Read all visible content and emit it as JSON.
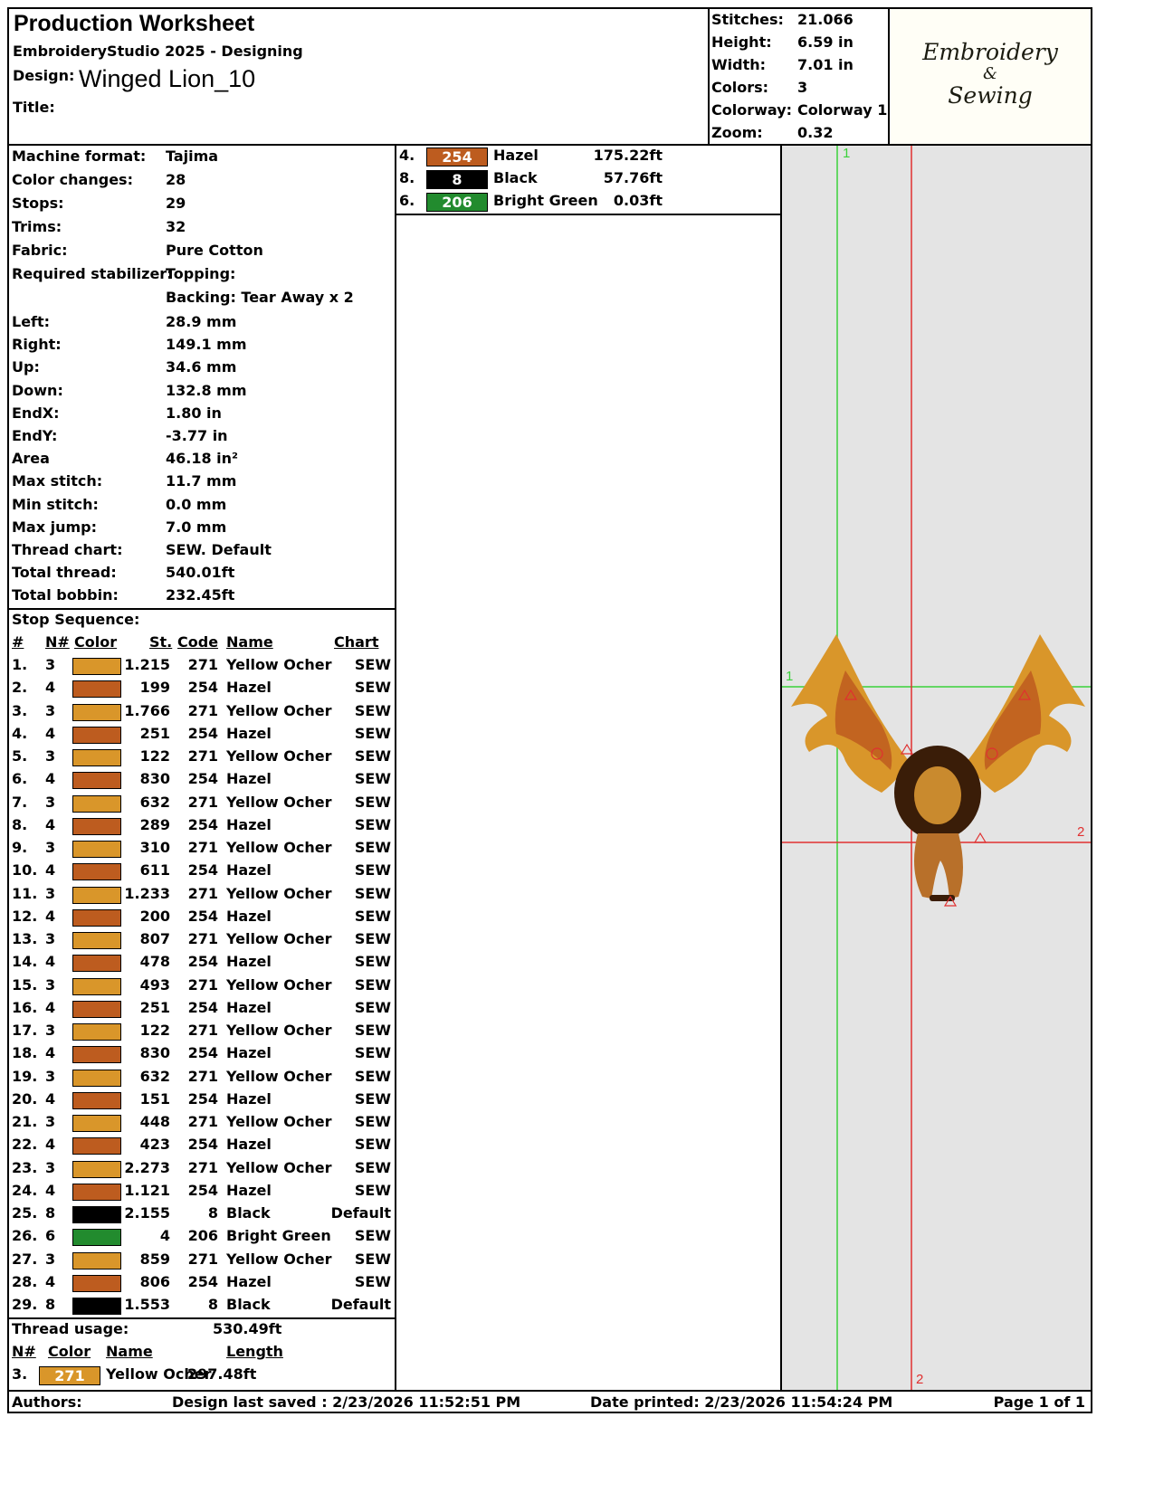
{
  "header": {
    "title": "Production Worksheet",
    "software": "EmbroideryStudio 2025 - Designing",
    "design_label": "Design:",
    "design_name": "Winged Lion_10",
    "title_label": "Title:",
    "title_value": ""
  },
  "summary": [
    {
      "label": "Stitches:",
      "value": "21.066"
    },
    {
      "label": "Height:",
      "value": "6.59 in"
    },
    {
      "label": "Width:",
      "value": "7.01 in"
    },
    {
      "label": "Colors:",
      "value": "3"
    },
    {
      "label": "Colorway:",
      "value": "Colorway 1"
    },
    {
      "label": "Zoom:",
      "value": "0.32"
    }
  ],
  "logo": {
    "line1": "Embroidery",
    "line2": "&",
    "line3": "Sewing"
  },
  "machine_info": [
    {
      "label": "Machine format:",
      "value": "Tajima"
    },
    {
      "label": "Color changes:",
      "value": "28"
    },
    {
      "label": "Stops:",
      "value": "29"
    },
    {
      "label": "Trims:",
      "value": "32"
    },
    {
      "label": "Fabric:",
      "value": "Pure Cotton"
    },
    {
      "label": "Required stabilizer:",
      "value": "Topping:"
    },
    {
      "label": "",
      "value": "Backing: Tear Away x 2"
    }
  ],
  "dimensions": [
    {
      "label": "Left:",
      "value": "28.9 mm"
    },
    {
      "label": "Right:",
      "value": "149.1 mm"
    },
    {
      "label": "Up:",
      "value": "34.6 mm"
    },
    {
      "label": "Down:",
      "value": "132.8 mm"
    },
    {
      "label": "EndX:",
      "value": "1.80 in"
    },
    {
      "label": "EndY:",
      "value": "-3.77 in"
    },
    {
      "label": "Area",
      "value": "46.18 in²"
    },
    {
      "label": "Max stitch:",
      "value": "11.7 mm"
    },
    {
      "label": "Min stitch:",
      "value": "0.0 mm"
    },
    {
      "label": "Max jump:",
      "value": "7.0 mm"
    },
    {
      "label": "Thread chart:",
      "value": "SEW. Default"
    },
    {
      "label": "Total thread:",
      "value": "540.01ft"
    },
    {
      "label": "Total bobbin:",
      "value": "232.45ft"
    }
  ],
  "stop_sequence": {
    "title": "Stop Sequence:",
    "headers": {
      "num": "#",
      "n": "N#",
      "color": "Color",
      "st": "St.",
      "code": "Code",
      "name": "Name",
      "chart": "Chart"
    },
    "rows": [
      {
        "num": "1.",
        "n": "3",
        "color": "#D9962A",
        "st": "1.215",
        "code": "271",
        "name": "Yellow Ocher",
        "chart": "SEW"
      },
      {
        "num": "2.",
        "n": "4",
        "color": "#BD5C1F",
        "st": "199",
        "code": "254",
        "name": "Hazel",
        "chart": "SEW"
      },
      {
        "num": "3.",
        "n": "3",
        "color": "#D9962A",
        "st": "1.766",
        "code": "271",
        "name": "Yellow Ocher",
        "chart": "SEW"
      },
      {
        "num": "4.",
        "n": "4",
        "color": "#BD5C1F",
        "st": "251",
        "code": "254",
        "name": "Hazel",
        "chart": "SEW"
      },
      {
        "num": "5.",
        "n": "3",
        "color": "#D9962A",
        "st": "122",
        "code": "271",
        "name": "Yellow Ocher",
        "chart": "SEW"
      },
      {
        "num": "6.",
        "n": "4",
        "color": "#BD5C1F",
        "st": "830",
        "code": "254",
        "name": "Hazel",
        "chart": "SEW"
      },
      {
        "num": "7.",
        "n": "3",
        "color": "#D9962A",
        "st": "632",
        "code": "271",
        "name": "Yellow Ocher",
        "chart": "SEW"
      },
      {
        "num": "8.",
        "n": "4",
        "color": "#BD5C1F",
        "st": "289",
        "code": "254",
        "name": "Hazel",
        "chart": "SEW"
      },
      {
        "num": "9.",
        "n": "3",
        "color": "#D9962A",
        "st": "310",
        "code": "271",
        "name": "Yellow Ocher",
        "chart": "SEW"
      },
      {
        "num": "10.",
        "n": "4",
        "color": "#BD5C1F",
        "st": "611",
        "code": "254",
        "name": "Hazel",
        "chart": "SEW"
      },
      {
        "num": "11.",
        "n": "3",
        "color": "#D9962A",
        "st": "1.233",
        "code": "271",
        "name": "Yellow Ocher",
        "chart": "SEW"
      },
      {
        "num": "12.",
        "n": "4",
        "color": "#BD5C1F",
        "st": "200",
        "code": "254",
        "name": "Hazel",
        "chart": "SEW"
      },
      {
        "num": "13.",
        "n": "3",
        "color": "#D9962A",
        "st": "807",
        "code": "271",
        "name": "Yellow Ocher",
        "chart": "SEW"
      },
      {
        "num": "14.",
        "n": "4",
        "color": "#BD5C1F",
        "st": "478",
        "code": "254",
        "name": "Hazel",
        "chart": "SEW"
      },
      {
        "num": "15.",
        "n": "3",
        "color": "#D9962A",
        "st": "493",
        "code": "271",
        "name": "Yellow Ocher",
        "chart": "SEW"
      },
      {
        "num": "16.",
        "n": "4",
        "color": "#BD5C1F",
        "st": "251",
        "code": "254",
        "name": "Hazel",
        "chart": "SEW"
      },
      {
        "num": "17.",
        "n": "3",
        "color": "#D9962A",
        "st": "122",
        "code": "271",
        "name": "Yellow Ocher",
        "chart": "SEW"
      },
      {
        "num": "18.",
        "n": "4",
        "color": "#BD5C1F",
        "st": "830",
        "code": "254",
        "name": "Hazel",
        "chart": "SEW"
      },
      {
        "num": "19.",
        "n": "3",
        "color": "#D9962A",
        "st": "632",
        "code": "271",
        "name": "Yellow Ocher",
        "chart": "SEW"
      },
      {
        "num": "20.",
        "n": "4",
        "color": "#BD5C1F",
        "st": "151",
        "code": "254",
        "name": "Hazel",
        "chart": "SEW"
      },
      {
        "num": "21.",
        "n": "3",
        "color": "#D9962A",
        "st": "448",
        "code": "271",
        "name": "Yellow Ocher",
        "chart": "SEW"
      },
      {
        "num": "22.",
        "n": "4",
        "color": "#BD5C1F",
        "st": "423",
        "code": "254",
        "name": "Hazel",
        "chart": "SEW"
      },
      {
        "num": "23.",
        "n": "3",
        "color": "#D9962A",
        "st": "2.273",
        "code": "271",
        "name": "Yellow Ocher",
        "chart": "SEW"
      },
      {
        "num": "24.",
        "n": "4",
        "color": "#BD5C1F",
        "st": "1.121",
        "code": "254",
        "name": "Hazel",
        "chart": "SEW"
      },
      {
        "num": "25.",
        "n": "8",
        "color": "#000000",
        "st": "2.155",
        "code": "8",
        "name": "Black",
        "chart": "Default"
      },
      {
        "num": "26.",
        "n": "6",
        "color": "#228B2E",
        "st": "4",
        "code": "206",
        "name": "Bright Green",
        "chart": "SEW"
      },
      {
        "num": "27.",
        "n": "3",
        "color": "#D9962A",
        "st": "859",
        "code": "271",
        "name": "Yellow Ocher",
        "chart": "SEW"
      },
      {
        "num": "28.",
        "n": "4",
        "color": "#BD5C1F",
        "st": "806",
        "code": "254",
        "name": "Hazel",
        "chart": "SEW"
      },
      {
        "num": "29.",
        "n": "8",
        "color": "#000000",
        "st": "1.553",
        "code": "8",
        "name": "Black",
        "chart": "Default"
      }
    ]
  },
  "thread_usage": {
    "label": "Thread usage:",
    "value": "530.49ft",
    "headers": {
      "n": "N#",
      "color": "Color",
      "name": "Name",
      "length": "Length"
    },
    "rows": [
      {
        "n": "3.",
        "color": "#D9962A",
        "code": "271",
        "name": "Yellow Ocher",
        "length": "297.48ft"
      }
    ]
  },
  "thread_usage_cont": [
    {
      "n": "4.",
      "color": "#BD5C1F",
      "code": "254",
      "name": "Hazel",
      "length": "175.22ft"
    },
    {
      "n": "8.",
      "color": "#000000",
      "code": "8",
      "name": "Black",
      "length": "57.76ft"
    },
    {
      "n": "6.",
      "color": "#228B2E",
      "code": "206",
      "name": "Bright Green",
      "length": "0.03ft"
    }
  ],
  "preview": {
    "marker_1_top": "1",
    "marker_1_left": "1",
    "marker_2_right": "2",
    "marker_2_bottom": "2"
  },
  "footer": {
    "authors": "Authors:",
    "last_saved": "Design last saved : 2/23/2026 11:52:51 PM",
    "printed": "Date printed: 2/23/2026 11:54:24 PM",
    "page": "Page 1 of 1"
  }
}
